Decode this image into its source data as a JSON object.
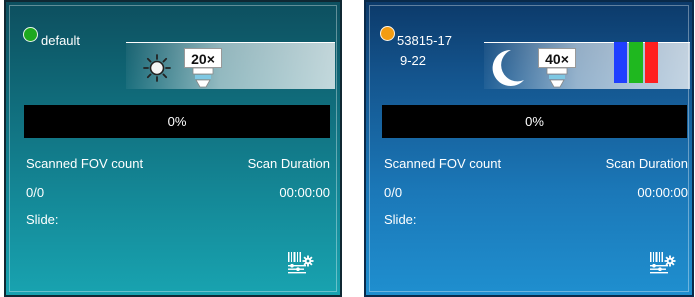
{
  "panels": [
    {
      "name_line1": "default",
      "name_line2": "",
      "status_color": "#1ea81e",
      "light_mode": "sun-icon",
      "objective": "20×",
      "channels_icon": "",
      "progress_percent": 0,
      "progress_text": "0%",
      "scanned_fov_label": "Scanned FOV count",
      "scan_duration_label": "Scan Duration",
      "fov_value": "0/0",
      "duration_value": "00:00:00",
      "slide_label": "Slide:",
      "slide_value": "",
      "settings_icon": "barcode-settings-icon"
    },
    {
      "name_line1": "53815-17",
      "name_line2": "9-22",
      "status_color": "#f39c12",
      "light_mode": "moon-icon",
      "objective": "40×",
      "channels_icon": "rgb-channels-icon",
      "channel_colors": [
        "#1f3fff",
        "#1fb81f",
        "#ff1f1f"
      ],
      "progress_percent": 0,
      "progress_text": "0%",
      "scanned_fov_label": "Scanned FOV count",
      "scan_duration_label": "Scan Duration",
      "fov_value": "0/0",
      "duration_value": "00:00:00",
      "slide_label": "Slide:",
      "slide_value": "",
      "settings_icon": "barcode-settings-icon"
    }
  ]
}
